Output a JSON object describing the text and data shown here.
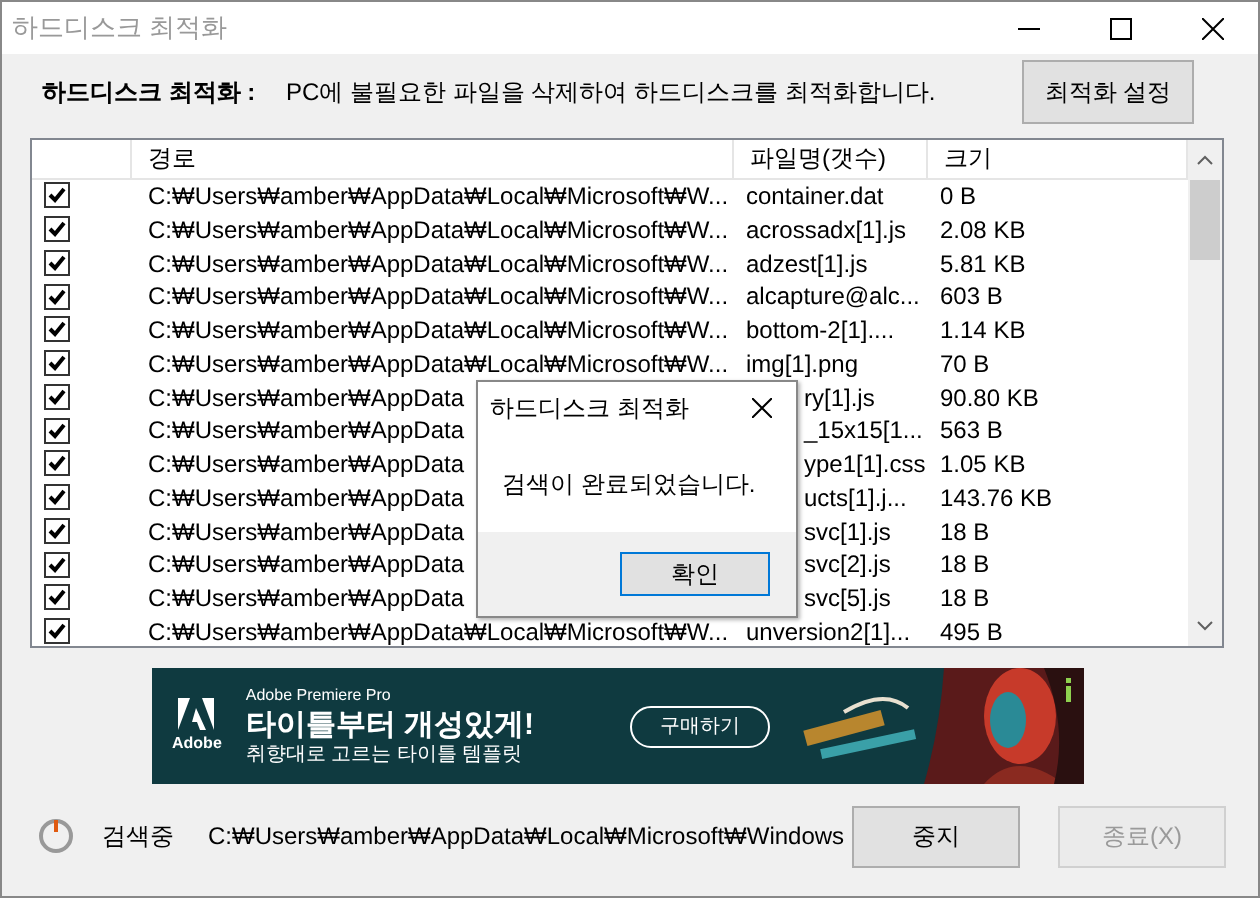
{
  "window": {
    "title": "하드디스크 최적화",
    "active": false
  },
  "header": {
    "label": "하드디스크 최적화 :",
    "description": "PC에 불필요한 파일을 삭제하여 하드디스크를 최적화합니다.",
    "button": "최적화 설정"
  },
  "table": {
    "columns": [
      "경로",
      "파일명(갯수)",
      "크기"
    ],
    "rows": [
      {
        "checked": true,
        "covered": false,
        "path": "C:₩Users₩amber₩AppData₩Local₩Microsoft₩W...",
        "file": "container.dat",
        "size": "0 B"
      },
      {
        "checked": true,
        "covered": false,
        "path": "C:₩Users₩amber₩AppData₩Local₩Microsoft₩W...",
        "file": "acrossadx[1].js",
        "size": "2.08 KB"
      },
      {
        "checked": true,
        "covered": false,
        "path": "C:₩Users₩amber₩AppData₩Local₩Microsoft₩W...",
        "file": "adzest[1].js",
        "size": "5.81 KB"
      },
      {
        "checked": true,
        "covered": false,
        "path": "C:₩Users₩amber₩AppData₩Local₩Microsoft₩W...",
        "file": "alcapture@alc...",
        "size": "603 B"
      },
      {
        "checked": true,
        "covered": false,
        "path": "C:₩Users₩amber₩AppData₩Local₩Microsoft₩W...",
        "file": "bottom-2[1]....",
        "size": "1.14 KB"
      },
      {
        "checked": true,
        "covered": false,
        "path": "C:₩Users₩amber₩AppData₩Local₩Microsoft₩W...",
        "file": "img[1].png",
        "size": "70 B"
      },
      {
        "checked": true,
        "covered": true,
        "path": "C:₩Users₩amber₩AppData",
        "file": "ry[1].js",
        "size": "90.80 KB"
      },
      {
        "checked": true,
        "covered": true,
        "path": "C:₩Users₩amber₩AppData",
        "file": "_15x15[1...",
        "size": "563 B"
      },
      {
        "checked": true,
        "covered": true,
        "path": "C:₩Users₩amber₩AppData",
        "file": "ype1[1].css",
        "size": "1.05 KB"
      },
      {
        "checked": true,
        "covered": true,
        "path": "C:₩Users₩amber₩AppData",
        "file": "ucts[1].j...",
        "size": "143.76 KB"
      },
      {
        "checked": true,
        "covered": true,
        "path": "C:₩Users₩amber₩AppData",
        "file": "svc[1].js",
        "size": "18 B"
      },
      {
        "checked": true,
        "covered": true,
        "path": "C:₩Users₩amber₩AppData",
        "file": "svc[2].js",
        "size": "18 B"
      },
      {
        "checked": true,
        "covered": true,
        "path": "C:₩Users₩amber₩AppData",
        "file": "svc[5].js",
        "size": "18 B"
      },
      {
        "checked": true,
        "covered": false,
        "path": "C:₩Users₩amber₩AppData₩Local₩Microsoft₩W...",
        "file": "unversion2[1]...",
        "size": "495 B"
      }
    ]
  },
  "ad": {
    "product": "Adobe Premiere Pro",
    "headline": "타이틀부터 개성있게!",
    "subline": "취향대로 고르는 타이틀 템플릿",
    "logo_text": "Adobe",
    "button": "구매하기"
  },
  "status": {
    "label": "검색중",
    "path": "C:₩Users₩amber₩AppData₩Local₩Microsoft₩Windows",
    "buttons": [
      {
        "label": "중지",
        "disabled": false
      },
      {
        "label": "종료(X)",
        "disabled": true
      }
    ]
  },
  "dialog": {
    "title": "하드디스크 최적화",
    "message": "검색이 완료되었습니다.",
    "button": "확인"
  }
}
